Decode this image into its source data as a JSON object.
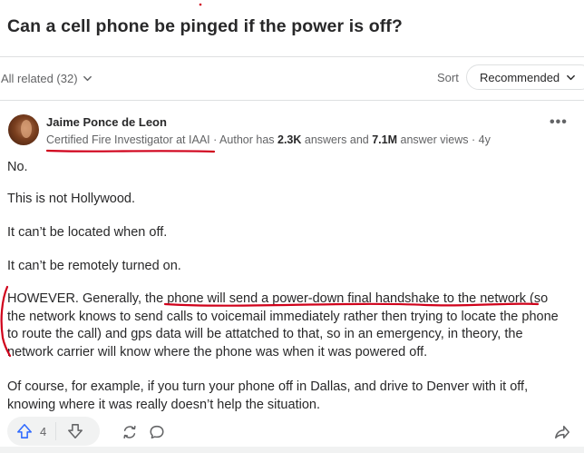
{
  "question": {
    "title": "Can a cell phone be pinged if the power is off?"
  },
  "filter": {
    "all_related": "All related (32)",
    "sort_label": "Sort",
    "sort_value": "Recommended"
  },
  "author": {
    "name": "Jaime Ponce de Leon",
    "credential": "Certified Fire Investigator at IAAI",
    "has_text": " · Author has ",
    "answers_count": "2.3K",
    "answers_text": " answers and ",
    "views_count": "7.1M",
    "views_text": " answer views · 4y"
  },
  "answer": {
    "paragraphs": [
      "No.",
      "This is not Hollywood.",
      "It can’t be located when off.",
      "It can’t be remotely turned on.",
      "HOWEVER. Generally, the phone will send a power-down final handshake to the network (so the network knows to send calls to voicemail immediately rather then trying to locate the phone to route the call) and gps data will be attatched to that, so in an emergency, in theory, the network carrier will know where the phone was when it was powered off.",
      "Of course, for example, if you turn your phone off in Dallas, and drive to Denver with it off, knowing where it was really doesn’t help the situation."
    ]
  },
  "actions": {
    "upvote_count": "4"
  },
  "icons": {
    "more": "more-horizontal-icon",
    "upvote": "upvote-arrow-icon",
    "downvote": "downvote-arrow-icon",
    "share": "share-rotate-icon",
    "comment": "comment-bubble-icon",
    "forward": "forward-share-icon",
    "chevron": "chevron-down-icon"
  },
  "colors": {
    "annotation_red": "#d0021b",
    "upvote_blue": "#2e69ff",
    "text": "#282829",
    "muted": "#636466"
  }
}
